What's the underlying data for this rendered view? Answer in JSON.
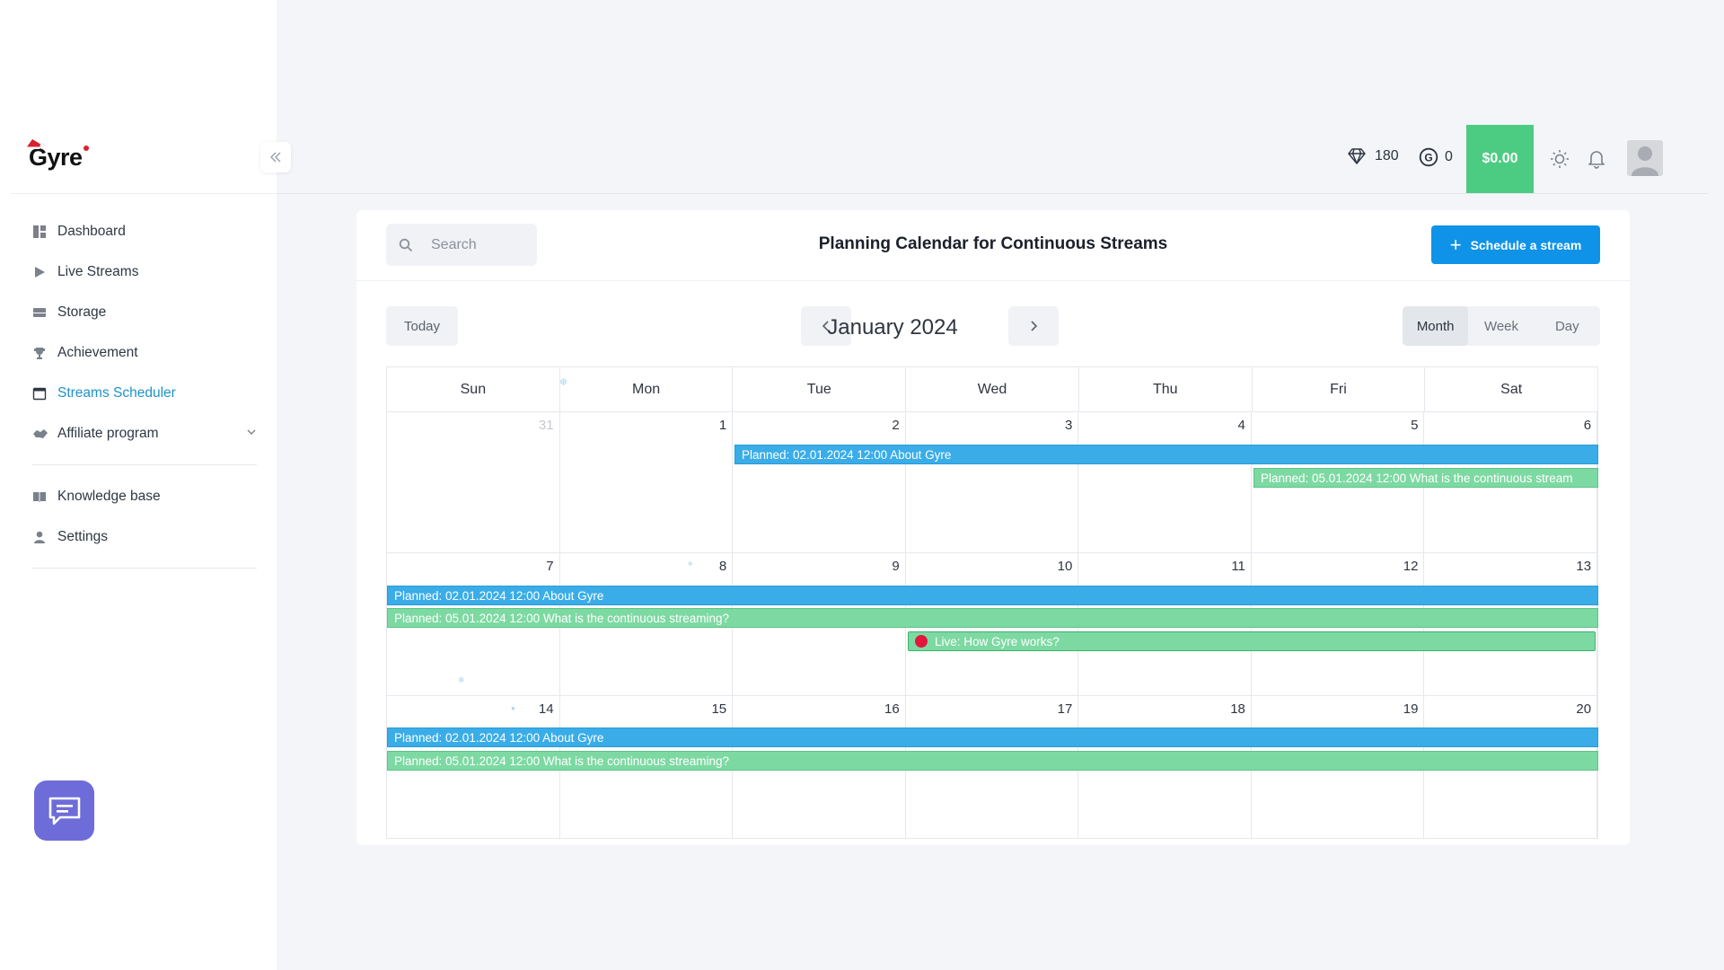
{
  "app": {
    "logo_text": "Gyre",
    "brand_accent": "#1e92c8"
  },
  "sidebar": {
    "items": [
      {
        "label": "Dashboard",
        "icon": "dashboard-icon"
      },
      {
        "label": "Live Streams",
        "icon": "play-icon"
      },
      {
        "label": "Storage",
        "icon": "storage-icon"
      },
      {
        "label": "Achievement",
        "icon": "trophy-icon"
      },
      {
        "label": "Streams Scheduler",
        "icon": "calendar-icon",
        "active": true
      },
      {
        "label": "Affiliate program",
        "icon": "handshake-icon",
        "expandable": true
      }
    ],
    "secondary_items": [
      {
        "label": "Knowledge base",
        "icon": "book-icon"
      },
      {
        "label": "Settings",
        "icon": "user-icon"
      }
    ]
  },
  "topbar": {
    "diamonds": "180",
    "coins": "0",
    "balance": "$0.00",
    "balance_color": "#4ccc82"
  },
  "page": {
    "title": "Planning Calendar for Continuous Streams",
    "search_placeholder": "Search",
    "schedule_button": "Schedule a stream",
    "schedule_button_color": "#0f93e8"
  },
  "calendar": {
    "today_button": "Today",
    "month_label": "January 2024",
    "views": [
      "Month",
      "Week",
      "Day"
    ],
    "active_view": "Month",
    "weekdays": [
      "Sun",
      "Mon",
      "Tue",
      "Wed",
      "Thu",
      "Fri",
      "Sat"
    ],
    "weeks": [
      [
        "31",
        "1",
        "2",
        "3",
        "4",
        "5",
        "6"
      ],
      [
        "7",
        "8",
        "9",
        "10",
        "11",
        "12",
        "13"
      ],
      [
        "14",
        "15",
        "16",
        "17",
        "18",
        "19",
        "20"
      ]
    ],
    "events": {
      "about_gyre": "Planned: 02.01.2024 12:00 About Gyre",
      "continuous": "Planned: 05.01.2024 12:00 What is the continuous streaming?",
      "continuous_short": "Planned: 05.01.2024 12:00 What is the continuous stream",
      "live": "Live: How Gyre works?"
    },
    "colors": {
      "planned_blue": "#3aade8",
      "planned_green": "#7dd9a2",
      "live_dot": "#e3173e"
    }
  }
}
